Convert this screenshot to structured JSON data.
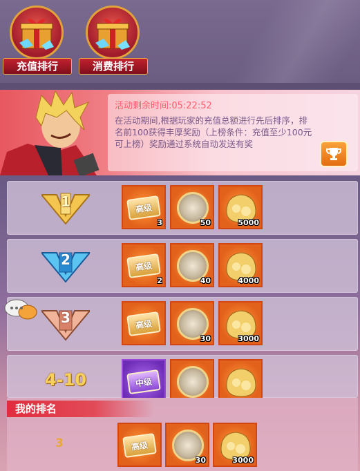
{
  "tabs": [
    {
      "label": "充值排行",
      "icon": "gift-icon",
      "selected": true
    },
    {
      "label": "消费排行",
      "icon": "gift-icon",
      "selected": false
    }
  ],
  "info": {
    "timer": "活动剩余时间:05:22:52",
    "desc": "在活动期间,根据玩家的充值总额进行先后排序，排名前100获得丰厚奖励（上榜条件：充值至少100元可上榜）奖励通过系统自动发送有奖"
  },
  "ranks": [
    {
      "rank": "1",
      "rewards": [
        {
          "type": "ticket",
          "label": "高级",
          "qty": "3"
        },
        {
          "type": "coin",
          "qty": "50"
        },
        {
          "type": "bag",
          "qty": "5000"
        }
      ]
    },
    {
      "rank": "2",
      "rewards": [
        {
          "type": "ticket",
          "label": "高级",
          "qty": "2"
        },
        {
          "type": "coin",
          "qty": "40"
        },
        {
          "type": "bag",
          "qty": "4000"
        }
      ]
    },
    {
      "rank": "3",
      "rewards": [
        {
          "type": "ticket",
          "label": "高级",
          "qty": ""
        },
        {
          "type": "coin",
          "qty": "30"
        },
        {
          "type": "bag",
          "qty": "3000"
        }
      ]
    },
    {
      "rank": "4-10",
      "rewards": [
        {
          "type": "ticket",
          "label": "中级",
          "qty": ""
        },
        {
          "type": "coin",
          "qty": ""
        },
        {
          "type": "bag",
          "qty": ""
        }
      ]
    }
  ],
  "my_rank": {
    "title": "我的排名",
    "rank": "3",
    "rewards": [
      {
        "type": "ticket",
        "label": "高级",
        "qty": ""
      },
      {
        "type": "coin",
        "qty": "30"
      },
      {
        "type": "bag",
        "qty": "3000"
      }
    ]
  },
  "colors": {
    "accent": "#e2611b",
    "red": "#c42330",
    "timer": "#ff5d6c"
  }
}
